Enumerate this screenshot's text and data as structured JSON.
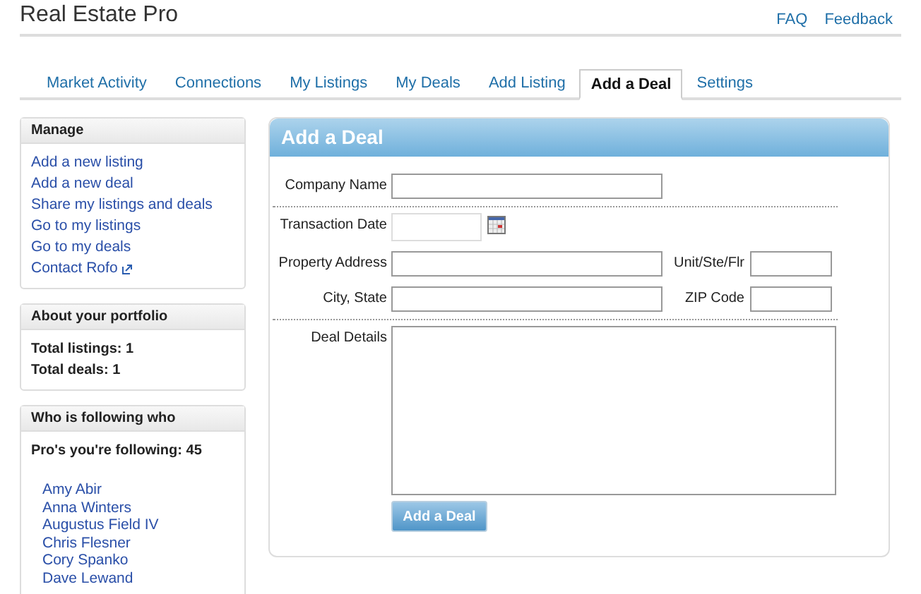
{
  "header": {
    "title": "Real Estate Pro",
    "links": [
      "FAQ",
      "Feedback"
    ]
  },
  "tabs": [
    {
      "label": "Market Activity",
      "selected": false
    },
    {
      "label": "Connections",
      "selected": false
    },
    {
      "label": "My Listings",
      "selected": false
    },
    {
      "label": "My Deals",
      "selected": false
    },
    {
      "label": "Add Listing",
      "selected": false
    },
    {
      "label": "Add a Deal",
      "selected": true
    },
    {
      "label": "Settings",
      "selected": false
    }
  ],
  "sidebar": {
    "manage": {
      "title": "Manage",
      "links": [
        {
          "label": "Add a new listing",
          "external": false
        },
        {
          "label": "Add a new deal",
          "external": false
        },
        {
          "label": "Share my listings and deals",
          "external": false
        },
        {
          "label": "Go to my listings",
          "external": false
        },
        {
          "label": "Go to my deals",
          "external": false
        },
        {
          "label": "Contact Rofo",
          "external": true
        }
      ]
    },
    "portfolio": {
      "title": "About your portfolio",
      "stats": [
        "Total listings: 1",
        "Total deals: 1"
      ]
    },
    "following": {
      "title": "Who is following who",
      "summary": "Pro's you're following: 45",
      "people": [
        "Amy Abir",
        "Anna Winters",
        "Augustus Field IV",
        "Chris Flesner",
        "Cory Spanko",
        "Dave Lewand"
      ]
    }
  },
  "form": {
    "title": "Add a Deal",
    "sections": [
      {
        "rows": [
          [
            {
              "label": "Company Name",
              "kind": "wide"
            }
          ]
        ]
      },
      {
        "rows": [
          [
            {
              "label": "Transaction Date",
              "kind": "date"
            }
          ],
          [
            {
              "label": "Property Address",
              "kind": "wide"
            },
            {
              "label": "Unit/Ste/Flr",
              "kind": "short"
            }
          ],
          [
            {
              "label": "City, State",
              "kind": "wide"
            },
            {
              "label": "ZIP Code",
              "kind": "short"
            }
          ]
        ]
      },
      {
        "rows": [
          [
            {
              "label": "Deal Details",
              "kind": "textarea"
            }
          ]
        ]
      }
    ],
    "submit": "Add a Deal"
  }
}
